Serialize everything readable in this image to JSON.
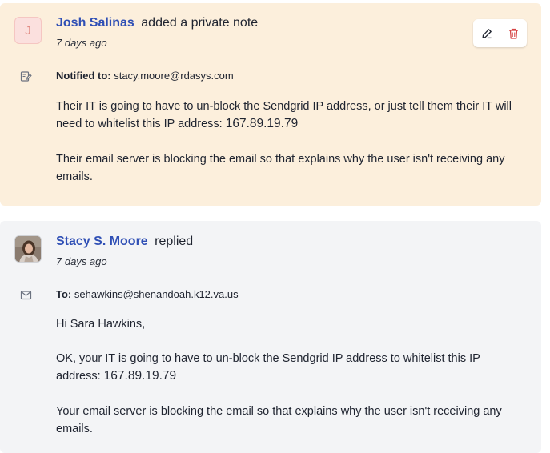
{
  "note": {
    "avatar_letter": "J",
    "author": "Josh Salinas",
    "action": "added a private note",
    "time": "7 days ago",
    "notified_label": "Notified to:",
    "notified_value": "stacy.moore@rdasys.com",
    "para1_text": "Their IT is going to have to un-block the Sendgrid IP address, or just tell them their IT will need to whitelist this IP address: ",
    "para1_ip": "167.89.19.79",
    "para2": "Their email server is blocking the email so that explains why the user isn't receiving any emails.",
    "icons": {
      "meta": "edit-note-icon",
      "edit": "pencil-icon",
      "delete": "trash-icon"
    }
  },
  "reply": {
    "author": "Stacy S. Moore",
    "action": "replied",
    "time": "7 days ago",
    "to_label": "To:",
    "to_value": "sehawkins@shenandoah.k12.va.us",
    "greeting": "Hi Sara Hawkins,",
    "para1_text": "OK, your  IT is going to have to un-block the Sendgrid IP address to whitelist this IP address: ",
    "para1_ip": "167.89.19.79",
    "para2": "Your email server is blocking the email so that explains why the user isn't receiving any emails.",
    "icons": {
      "meta": "envelope-icon"
    }
  },
  "colors": {
    "note_bg": "#fcefdc",
    "reply_bg": "#f3f4f6",
    "author": "#2f4fb5",
    "delete": "#d64545"
  }
}
